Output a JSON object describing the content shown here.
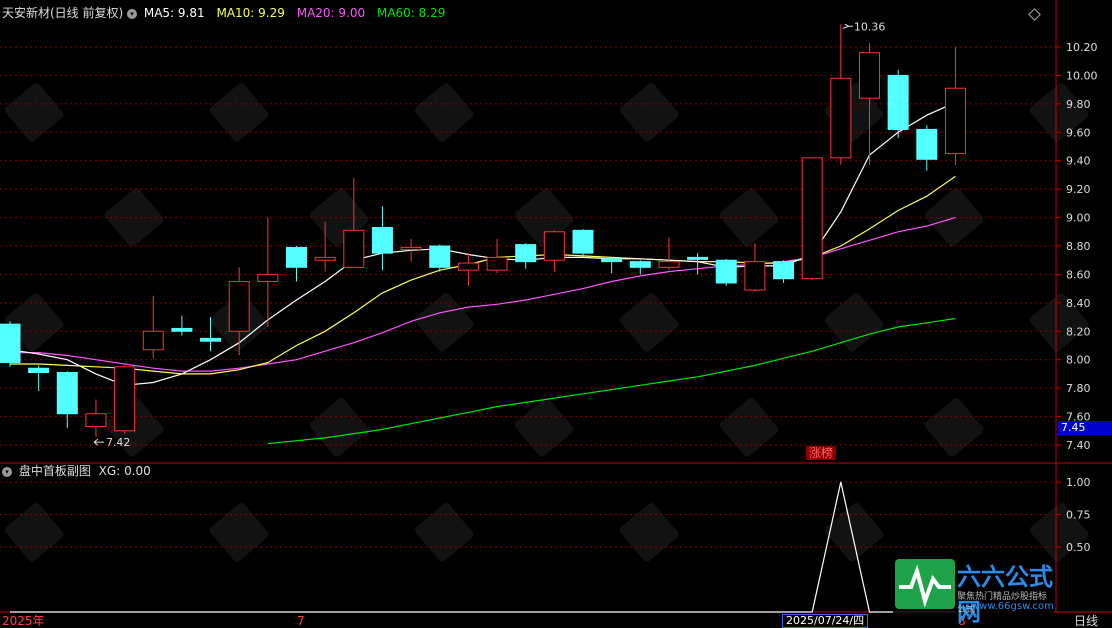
{
  "header": {
    "stock": "天安新材(日线 前复权)",
    "ma5_label": "MA5:",
    "ma5_value": "9.81",
    "ma10_label": "MA10:",
    "ma10_value": "9.29",
    "ma20_label": "MA20:",
    "ma20_value": "9.00",
    "ma60_label": "MA60:",
    "ma60_value": "8.29"
  },
  "sub_header": {
    "title": "盘中首板副图",
    "xg_label": "XG:",
    "xg_value": "0.00"
  },
  "price_axis": {
    "ticks": [
      "10.20",
      "10.00",
      "9.80",
      "9.60",
      "9.40",
      "9.20",
      "9.00",
      "8.80",
      "8.60",
      "8.40",
      "8.20",
      "8.00",
      "7.80",
      "7.60",
      "7.40"
    ],
    "last_price": "7.45"
  },
  "sub_axis": {
    "ticks": [
      "1.00",
      "0.75",
      "0.50"
    ]
  },
  "bottom_axis": {
    "start": "2025年",
    "month": "7",
    "cursor_date": "2025/07/24/四",
    "right_mark": "8",
    "period": "日线"
  },
  "annotations": {
    "high": "10.36",
    "low": "7.42",
    "zhangbang": "涨榜"
  },
  "watermark": {
    "brand": "六六公式网",
    "slogan": "聚焦热门精品炒股指标公式",
    "url": "www.66gsw.com"
  },
  "colors": {
    "up": "#ff3232",
    "down": "#54ffff",
    "ma5": "#ffffff",
    "ma10": "#ffff54",
    "ma20": "#ff54ff",
    "ma60": "#00e600",
    "grid": "#8b0000"
  },
  "chart_data": {
    "type": "candlestick",
    "y_range": [
      7.32,
      10.4
    ],
    "candles": [
      {
        "o": 8.25,
        "h": 8.27,
        "l": 7.95,
        "c": 7.98
      },
      {
        "o": 7.94,
        "h": 7.96,
        "l": 7.78,
        "c": 7.91
      },
      {
        "o": 7.91,
        "h": 7.92,
        "l": 7.52,
        "c": 7.62
      },
      {
        "o": 7.53,
        "h": 7.72,
        "l": 7.46,
        "c": 7.62
      },
      {
        "o": 7.5,
        "h": 7.96,
        "l": 7.48,
        "c": 7.95
      },
      {
        "o": 8.07,
        "h": 8.45,
        "l": 8.01,
        "c": 8.2
      },
      {
        "o": 8.22,
        "h": 8.31,
        "l": 8.17,
        "c": 8.2
      },
      {
        "o": 8.15,
        "h": 8.3,
        "l": 8.06,
        "c": 8.13
      },
      {
        "o": 8.2,
        "h": 8.65,
        "l": 8.03,
        "c": 8.55
      },
      {
        "o": 8.55,
        "h": 9.0,
        "l": 8.23,
        "c": 8.6
      },
      {
        "o": 8.79,
        "h": 8.8,
        "l": 8.55,
        "c": 8.65
      },
      {
        "o": 8.7,
        "h": 8.97,
        "l": 8.62,
        "c": 8.72
      },
      {
        "o": 8.65,
        "h": 9.28,
        "l": 8.65,
        "c": 8.91
      },
      {
        "o": 8.93,
        "h": 9.08,
        "l": 8.63,
        "c": 8.75
      },
      {
        "o": 8.79,
        "h": 8.85,
        "l": 8.69,
        "c": 8.79
      },
      {
        "o": 8.8,
        "h": 8.81,
        "l": 8.62,
        "c": 8.65
      },
      {
        "o": 8.63,
        "h": 8.75,
        "l": 8.52,
        "c": 8.68
      },
      {
        "o": 8.63,
        "h": 8.85,
        "l": 8.61,
        "c": 8.72
      },
      {
        "o": 8.81,
        "h": 8.82,
        "l": 8.64,
        "c": 8.69
      },
      {
        "o": 8.7,
        "h": 8.91,
        "l": 8.62,
        "c": 8.9
      },
      {
        "o": 8.91,
        "h": 8.92,
        "l": 8.73,
        "c": 8.75
      },
      {
        "o": 8.71,
        "h": 8.72,
        "l": 8.61,
        "c": 8.69
      },
      {
        "o": 8.69,
        "h": 8.7,
        "l": 8.6,
        "c": 8.65
      },
      {
        "o": 8.65,
        "h": 8.86,
        "l": 8.63,
        "c": 8.69
      },
      {
        "o": 8.72,
        "h": 8.75,
        "l": 8.6,
        "c": 8.71
      },
      {
        "o": 8.7,
        "h": 8.71,
        "l": 8.52,
        "c": 8.54
      },
      {
        "o": 8.49,
        "h": 8.82,
        "l": 8.48,
        "c": 8.69
      },
      {
        "o": 8.69,
        "h": 8.7,
        "l": 8.54,
        "c": 8.57
      },
      {
        "o": 8.57,
        "h": 9.42,
        "l": 8.56,
        "c": 9.42
      },
      {
        "o": 9.42,
        "h": 10.36,
        "l": 9.37,
        "c": 9.98
      },
      {
        "o": 9.84,
        "h": 10.23,
        "l": 9.37,
        "c": 10.16
      },
      {
        "o": 10.0,
        "h": 10.04,
        "l": 9.56,
        "c": 9.62
      },
      {
        "o": 9.62,
        "h": 9.65,
        "l": 9.33,
        "c": 9.41
      },
      {
        "o": 9.45,
        "h": 10.2,
        "l": 9.37,
        "c": 9.91
      }
    ],
    "ma5": [
      8.07,
      8.04,
      8.0,
      7.9,
      7.82,
      7.84,
      7.9,
      8.0,
      8.12,
      8.28,
      8.42,
      8.55,
      8.7,
      8.75,
      8.77,
      8.78,
      8.74,
      8.71,
      8.7,
      8.72,
      8.72,
      8.71,
      8.71,
      8.7,
      8.69,
      8.65,
      8.66,
      8.66,
      8.74,
      9.04,
      9.44,
      9.6,
      9.72,
      9.81
    ],
    "ma10": [
      7.97,
      7.97,
      7.96,
      7.95,
      7.94,
      7.92,
      7.9,
      7.9,
      7.93,
      7.98,
      8.1,
      8.2,
      8.33,
      8.47,
      8.56,
      8.63,
      8.67,
      8.72,
      8.73,
      8.74,
      8.73,
      8.72,
      8.71,
      8.7,
      8.69,
      8.69,
      8.68,
      8.68,
      8.72,
      8.8,
      8.92,
      9.05,
      9.15,
      9.29
    ],
    "ma20_start": 0,
    "ma20": [
      8.05,
      8.05,
      8.03,
      8.0,
      7.97,
      7.94,
      7.92,
      7.92,
      7.94,
      7.97,
      8.0,
      8.06,
      8.12,
      8.19,
      8.27,
      8.33,
      8.37,
      8.39,
      8.42,
      8.46,
      8.5,
      8.55,
      8.59,
      8.62,
      8.64,
      8.66,
      8.67,
      8.69,
      8.72,
      8.78,
      8.84,
      8.9,
      8.94,
      9.0
    ],
    "ma60_start": 9,
    "ma60": [
      7.41,
      7.43,
      7.45,
      7.48,
      7.51,
      7.55,
      7.59,
      7.63,
      7.67,
      7.7,
      7.73,
      7.76,
      7.79,
      7.82,
      7.85,
      7.88,
      7.92,
      7.96,
      8.01,
      8.06,
      8.12,
      8.18,
      8.23,
      8.26,
      8.29
    ],
    "sub_xg": [
      0,
      0,
      0,
      0,
      0,
      0,
      0,
      0,
      0,
      0,
      0,
      0,
      0,
      0,
      0,
      0,
      0,
      0,
      0,
      0,
      0,
      0,
      0,
      0,
      0,
      0,
      0,
      0,
      0,
      1,
      0,
      0,
      0,
      0
    ],
    "sub_y_range": [
      0,
      1
    ]
  }
}
